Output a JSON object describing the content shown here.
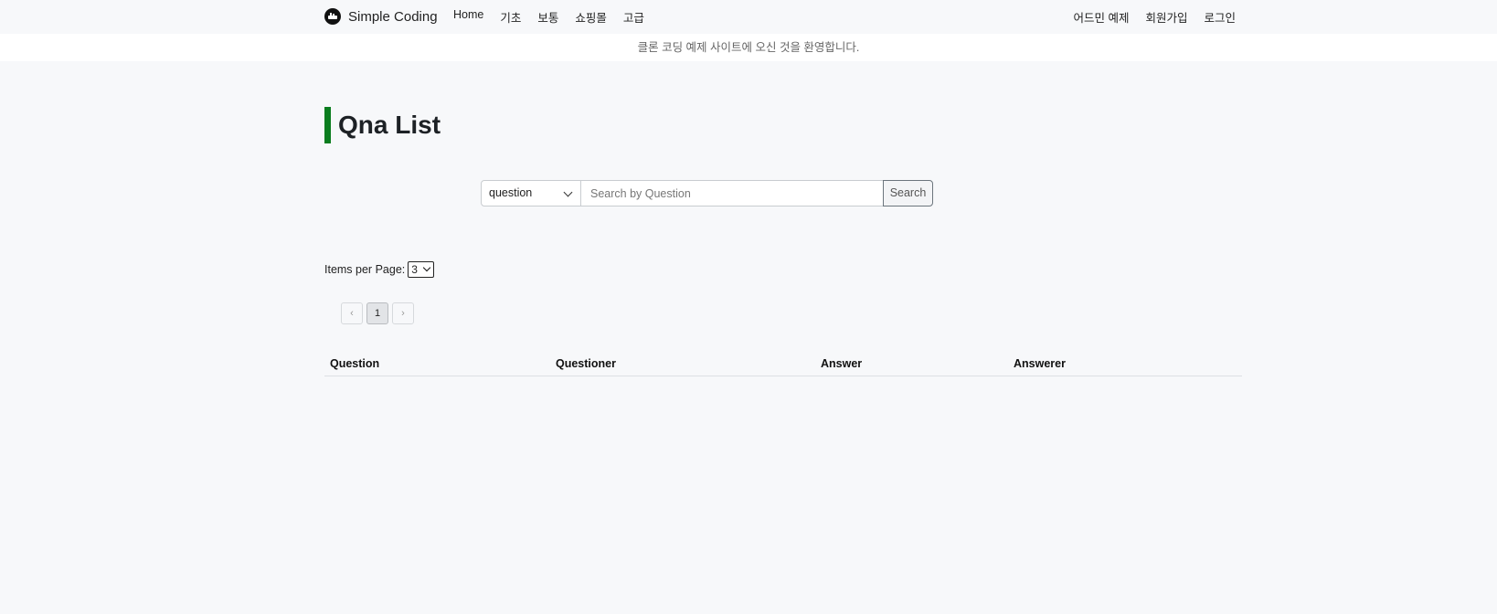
{
  "nav": {
    "brand": "Simple Coding",
    "links": [
      "Home",
      "기초",
      "보통",
      "쇼핑몰",
      "고급"
    ],
    "right_links": [
      "어드민 예제",
      "회원가입",
      "로그인"
    ]
  },
  "notice": "클론 코딩 예제 사이트에 오신 것을 환영합니다.",
  "page_title": "Qna List",
  "search": {
    "field_selected": "question",
    "placeholder": "Search by Question",
    "button_label": "Search"
  },
  "items_per_page": {
    "label": "Items per Page:",
    "value": "3"
  },
  "pagination": {
    "prev": "‹",
    "current": "1",
    "next": "›"
  },
  "table": {
    "columns": [
      "Question",
      "Questioner",
      "Answer",
      "Answerer"
    ]
  },
  "colors": {
    "title_accent": "#0a7d1e",
    "background": "#f7f8fa"
  }
}
